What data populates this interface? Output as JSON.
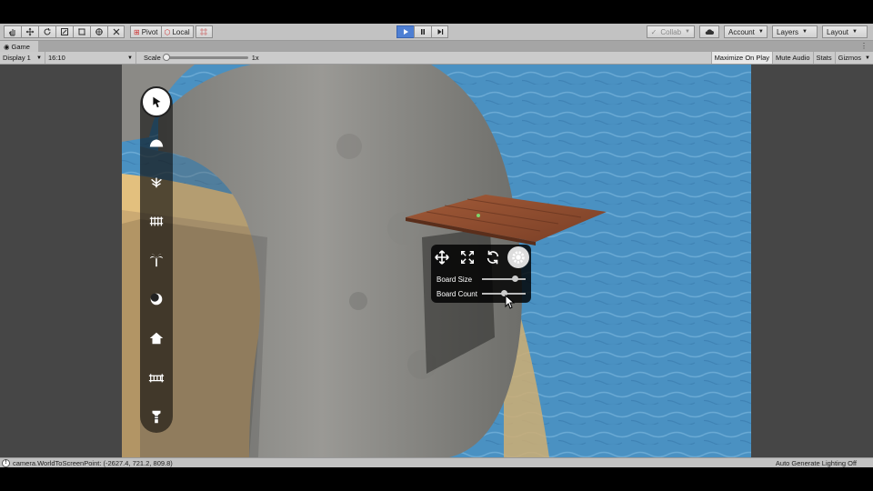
{
  "toolbar": {
    "transform_tools": [
      "hand-icon",
      "move-icon",
      "rotate-icon",
      "scale-icon",
      "rect-icon",
      "transform-icon",
      "custom-tool-icon"
    ],
    "pivot_label": "Pivot",
    "local_label": "Local",
    "collab_label": "Collab",
    "account_label": "Account",
    "layers_label": "Layers",
    "layout_label": "Layout"
  },
  "tab": {
    "label": "Game"
  },
  "game_view": {
    "display": "Display 1",
    "aspect": "16:10",
    "scale_label": "Scale",
    "scale_value": "1x",
    "maximize_on_play": "Maximize On Play",
    "mute_audio": "Mute Audio",
    "stats": "Stats",
    "gizmos": "Gizmos"
  },
  "game_ui": {
    "tools": [
      "pointer-icon",
      "rock-icon",
      "grass-icon",
      "fence-icon",
      "palm-tree-icon",
      "bush-icon",
      "house-icon",
      "bridge-icon",
      "tower-icon"
    ],
    "context_panel": {
      "icons": [
        "move-arrows-icon",
        "expand-icon",
        "rotate-icon",
        "settings-gear-icon"
      ],
      "board_size_label": "Board Size",
      "board_size_value": 0.75,
      "board_count_label": "Board Count",
      "board_count_value": 0.5
    }
  },
  "status": {
    "message": "camera.WorldToScreenPoint: (-2627.4, 721.2, 809.8)",
    "right": "Auto Generate Lighting Off"
  },
  "colors": {
    "accent_play": "#4e7fd3",
    "water": "#4e95c0",
    "sand": "#e3c07e",
    "rock": "#8c8c88",
    "wood": "#8a4a2e"
  }
}
